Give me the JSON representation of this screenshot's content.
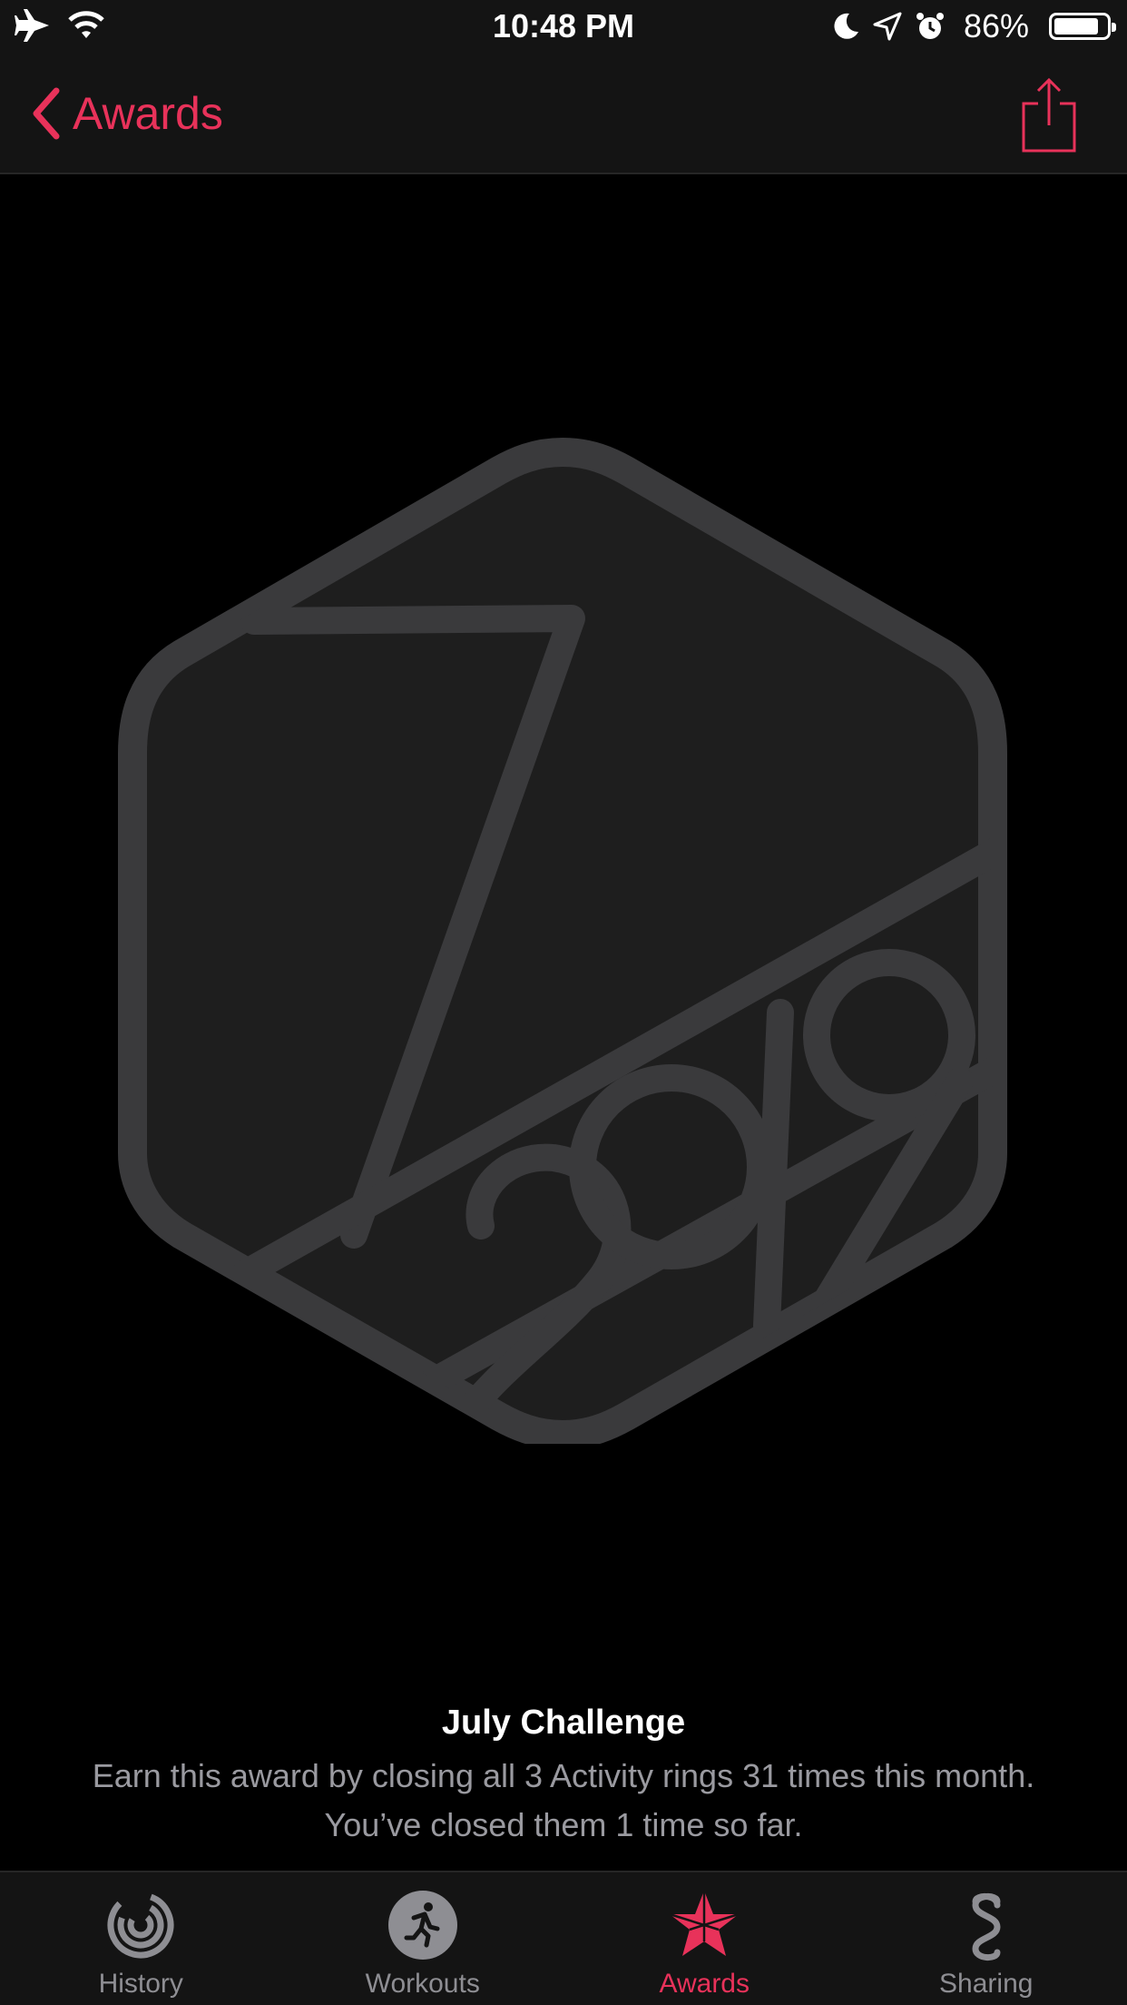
{
  "status_bar": {
    "time": "10:48 PM",
    "battery_percent": "86%",
    "battery_level": 0.86,
    "icons": [
      "airplane-icon",
      "wifi-icon",
      "moon-icon",
      "location-icon",
      "alarm-icon",
      "battery-icon"
    ]
  },
  "nav": {
    "back_label": "Awards",
    "back_icon": "chevron-left-icon",
    "share_icon": "share-icon",
    "accent_color": "#e8325a"
  },
  "badge": {
    "icon": "july-2019-challenge-badge"
  },
  "award": {
    "title": "July Challenge",
    "description": "Earn this award by closing all 3 Activity rings 31 times this month. You’ve closed them 1 time so far."
  },
  "tabs": [
    {
      "label": "History",
      "icon": "history-rings-icon",
      "active": false
    },
    {
      "label": "Workouts",
      "icon": "workouts-runner-icon",
      "active": false
    },
    {
      "label": "Awards",
      "icon": "awards-star-icon",
      "active": true
    },
    {
      "label": "Sharing",
      "icon": "sharing-icon",
      "active": false
    }
  ]
}
